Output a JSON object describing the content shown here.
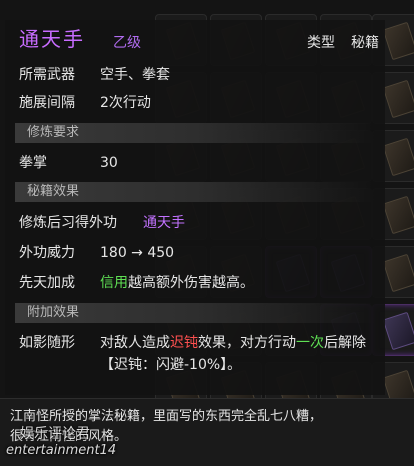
{
  "item": {
    "name": "通天手",
    "grade": "乙级",
    "type_label": "类型",
    "type_value": "秘籍"
  },
  "basic": [
    {
      "label": "所需武器",
      "value": "空手、拳套"
    },
    {
      "label": "施展间隔",
      "value": "2次行动"
    }
  ],
  "sections": {
    "requirements": "修炼要求",
    "effects": "秘籍效果",
    "extra": "附加效果"
  },
  "requirements": [
    {
      "label": "拳掌",
      "value": "30"
    }
  ],
  "effects": {
    "learn_label": "修炼后习得外功",
    "learn_value": "通天手",
    "power_label": "外功威力",
    "power_value": "180 → 450",
    "innate_label": "先天加成",
    "innate_attr": "信用",
    "innate_text": "越高额外伤害越高。"
  },
  "extra": {
    "name": "如影随形",
    "text_1": "对敌人造成",
    "keyword_1": "迟钝",
    "text_2": "效果，对方行动",
    "keyword_2": "一次",
    "text_3": "后解除",
    "detail": "【迟钝：闪避-10%】。"
  },
  "description": {
    "line1": "江南怪所授的掌法秘籍，里面写的东西完全乱七八糟，",
    "line2": "很有江南怪的风格。"
  },
  "watermark": {
    "cn": "娱乐评论君",
    "en": "entertainment14"
  },
  "colors": {
    "item_name": "#c86cff",
    "green": "#5fe054",
    "red": "#ff5050"
  }
}
